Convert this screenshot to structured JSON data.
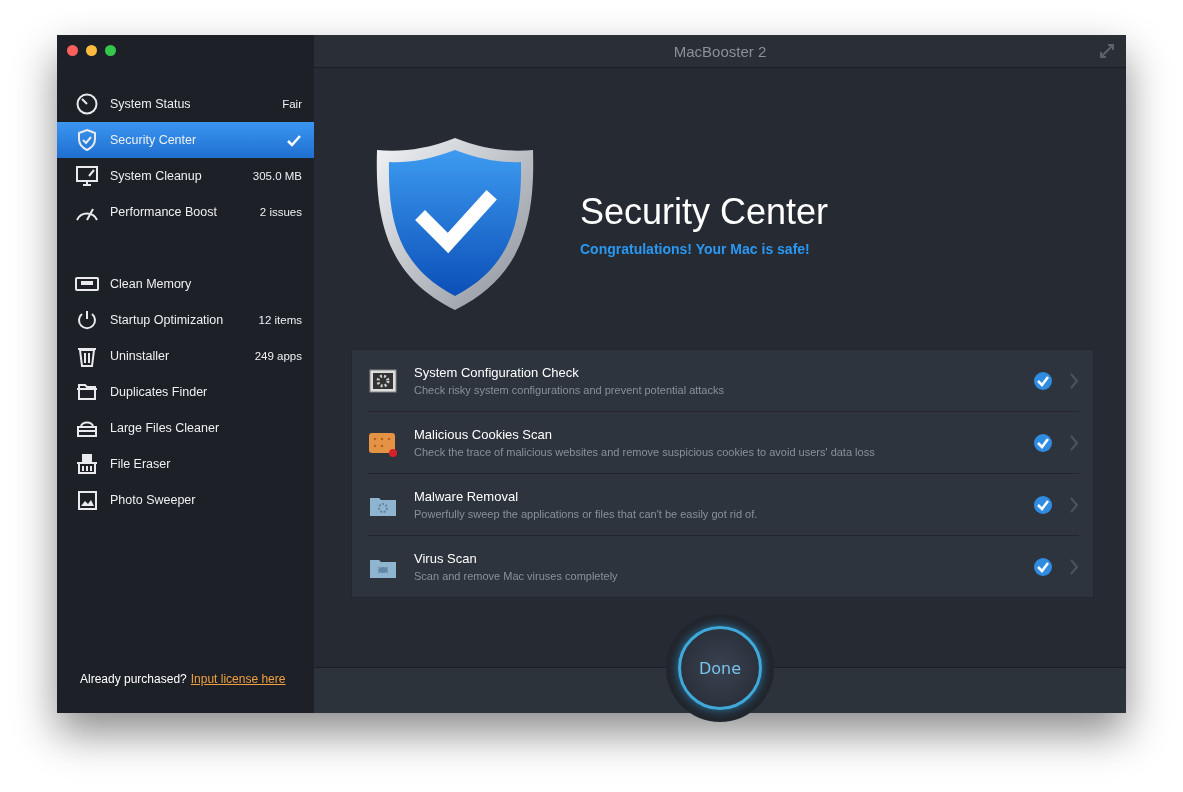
{
  "window": {
    "title": "MacBooster 2"
  },
  "sidebar": {
    "sections": [
      {
        "items": [
          {
            "label": "System Status",
            "value": "Fair",
            "selected": false
          },
          {
            "label": "Security Center",
            "selected": true
          },
          {
            "label": "System Cleanup",
            "value": "305.0 MB",
            "selected": false
          },
          {
            "label": "Performance Boost",
            "value": "2 issues",
            "selected": false
          }
        ]
      },
      {
        "items": [
          {
            "label": "Clean Memory",
            "selected": false
          },
          {
            "label": "Startup Optimization",
            "value": "12 items",
            "selected": false
          },
          {
            "label": "Uninstaller",
            "value": "249 apps",
            "selected": false
          },
          {
            "label": "Duplicates Finder",
            "selected": false
          },
          {
            "label": "Large Files Cleaner",
            "selected": false
          },
          {
            "label": "File Eraser",
            "selected": false
          },
          {
            "label": "Photo Sweeper",
            "selected": false
          }
        ]
      }
    ],
    "footer": {
      "text": "Already purchased?",
      "link": "Input license here"
    }
  },
  "main": {
    "title": "Security Center",
    "subtitle": "Congratulations! Your Mac is safe!",
    "checks": [
      {
        "title": "System Configuration Check",
        "description": "Check risky system configurations and prevent potential attacks",
        "checked": true
      },
      {
        "title": "Malicious Cookies Scan",
        "description": "Check the trace of malicious websites and remove suspicious cookies to avoid users' data loss",
        "checked": true
      },
      {
        "title": "Malware Removal",
        "description": "Powerfully sweep the applications or files that can't be easily got rid of.",
        "checked": true
      },
      {
        "title": "Virus Scan",
        "description": "Scan and remove Mac viruses completely",
        "checked": true
      }
    ],
    "done_button": "Done"
  }
}
